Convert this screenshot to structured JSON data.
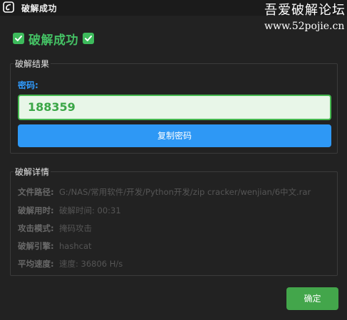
{
  "window": {
    "title": "破解成功"
  },
  "watermark": {
    "site_name": "吾爱破解论坛",
    "url": "www.52pojie.cn"
  },
  "headline": {
    "text": "破解成功"
  },
  "result_group": {
    "title": "破解结果",
    "password_label": "密码:",
    "password_value": "188359",
    "copy_button": "复制密码"
  },
  "details_group": {
    "title": "破解详情",
    "rows": [
      {
        "label": "文件路径:",
        "value": "G:/NAS/常用软件/开发/Python开发/zip cracker/wenjian/6中文.rar"
      },
      {
        "label": "破解用时:",
        "value": "破解时间: 00:31"
      },
      {
        "label": "攻击模式:",
        "value": "掩码攻击"
      },
      {
        "label": "破解引擎:",
        "value": "hashcat"
      },
      {
        "label": "平均速度:",
        "value": "速度: 36806 H/s"
      }
    ]
  },
  "ok_button": "确定",
  "colors": {
    "background": "#222222",
    "success_green": "#44c064",
    "primary_blue": "#2e98f5",
    "ok_green": "#43a64b"
  }
}
